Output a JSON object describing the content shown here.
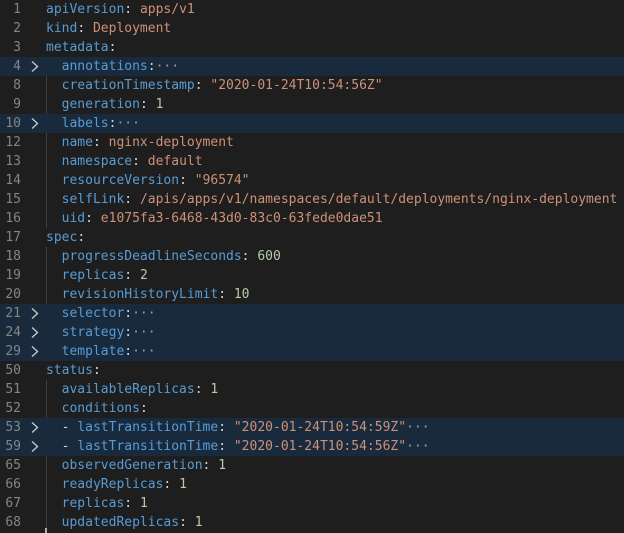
{
  "lines": [
    {
      "num": "1",
      "indent": "",
      "key": "apiVersion",
      "sep": ": ",
      "val": "apps/v1",
      "val_type": "s",
      "ellipsis": "",
      "folded": false
    },
    {
      "num": "2",
      "indent": "",
      "key": "kind",
      "sep": ": ",
      "val": "Deployment",
      "val_type": "s",
      "ellipsis": "",
      "folded": false
    },
    {
      "num": "3",
      "indent": "",
      "key": "metadata",
      "sep": ":",
      "val": "",
      "val_type": "s",
      "ellipsis": "",
      "folded": false
    },
    {
      "num": "4",
      "indent": "  ",
      "key": "annotations",
      "sep": ":",
      "val": "",
      "val_type": "s",
      "ellipsis": "···",
      "folded": true
    },
    {
      "num": "8",
      "indent": "  ",
      "key": "creationTimestamp",
      "sep": ": ",
      "val": "\"2020-01-24T10:54:56Z\"",
      "val_type": "s",
      "ellipsis": "",
      "folded": false
    },
    {
      "num": "9",
      "indent": "  ",
      "key": "generation",
      "sep": ": ",
      "val": "1",
      "val_type": "n",
      "ellipsis": "",
      "folded": false
    },
    {
      "num": "10",
      "indent": "  ",
      "key": "labels",
      "sep": ":",
      "val": "",
      "val_type": "s",
      "ellipsis": "···",
      "folded": true
    },
    {
      "num": "12",
      "indent": "  ",
      "key": "name",
      "sep": ": ",
      "val": "nginx-deployment",
      "val_type": "s",
      "ellipsis": "",
      "folded": false
    },
    {
      "num": "13",
      "indent": "  ",
      "key": "namespace",
      "sep": ": ",
      "val": "default",
      "val_type": "s",
      "ellipsis": "",
      "folded": false
    },
    {
      "num": "14",
      "indent": "  ",
      "key": "resourceVersion",
      "sep": ": ",
      "val": "\"96574\"",
      "val_type": "s",
      "ellipsis": "",
      "folded": false
    },
    {
      "num": "15",
      "indent": "  ",
      "key": "selfLink",
      "sep": ": ",
      "val": "/apis/apps/v1/namespaces/default/deployments/nginx-deployment",
      "val_type": "s",
      "ellipsis": "",
      "folded": false
    },
    {
      "num": "16",
      "indent": "  ",
      "key": "uid",
      "sep": ": ",
      "val": "e1075fa3-6468-43d0-83c0-63fede0dae51",
      "val_type": "s",
      "ellipsis": "",
      "folded": false
    },
    {
      "num": "17",
      "indent": "",
      "key": "spec",
      "sep": ":",
      "val": "",
      "val_type": "s",
      "ellipsis": "",
      "folded": false
    },
    {
      "num": "18",
      "indent": "  ",
      "key": "progressDeadlineSeconds",
      "sep": ": ",
      "val": "600",
      "val_type": "n",
      "ellipsis": "",
      "folded": false
    },
    {
      "num": "19",
      "indent": "  ",
      "key": "replicas",
      "sep": ": ",
      "val": "2",
      "val_type": "n",
      "ellipsis": "",
      "folded": false
    },
    {
      "num": "20",
      "indent": "  ",
      "key": "revisionHistoryLimit",
      "sep": ": ",
      "val": "10",
      "val_type": "n",
      "ellipsis": "",
      "folded": false
    },
    {
      "num": "21",
      "indent": "  ",
      "key": "selector",
      "sep": ":",
      "val": "",
      "val_type": "s",
      "ellipsis": "···",
      "folded": true
    },
    {
      "num": "24",
      "indent": "  ",
      "key": "strategy",
      "sep": ":",
      "val": "",
      "val_type": "s",
      "ellipsis": "···",
      "folded": true
    },
    {
      "num": "29",
      "indent": "  ",
      "key": "template",
      "sep": ":",
      "val": "",
      "val_type": "s",
      "ellipsis": "···",
      "folded": true
    },
    {
      "num": "50",
      "indent": "",
      "key": "status",
      "sep": ":",
      "val": "",
      "val_type": "s",
      "ellipsis": "",
      "folded": false
    },
    {
      "num": "51",
      "indent": "  ",
      "key": "availableReplicas",
      "sep": ": ",
      "val": "1",
      "val_type": "n",
      "ellipsis": "",
      "folded": false
    },
    {
      "num": "52",
      "indent": "  ",
      "key": "conditions",
      "sep": ":",
      "val": "",
      "val_type": "s",
      "ellipsis": "",
      "folded": false
    },
    {
      "num": "53",
      "indent": "  - ",
      "key": "lastTransitionTime",
      "sep": ": ",
      "val": "\"2020-01-24T10:54:59Z\"",
      "val_type": "s",
      "ellipsis": "···",
      "folded": true
    },
    {
      "num": "59",
      "indent": "  - ",
      "key": "lastTransitionTime",
      "sep": ": ",
      "val": "\"2020-01-24T10:54:56Z\"",
      "val_type": "s",
      "ellipsis": "···",
      "folded": true
    },
    {
      "num": "65",
      "indent": "  ",
      "key": "observedGeneration",
      "sep": ": ",
      "val": "1",
      "val_type": "n",
      "ellipsis": "",
      "folded": false
    },
    {
      "num": "66",
      "indent": "  ",
      "key": "readyReplicas",
      "sep": ": ",
      "val": "1",
      "val_type": "n",
      "ellipsis": "",
      "folded": false
    },
    {
      "num": "67",
      "indent": "  ",
      "key": "replicas",
      "sep": ": ",
      "val": "1",
      "val_type": "n",
      "ellipsis": "",
      "folded": false
    },
    {
      "num": "68",
      "indent": "  ",
      "key": "updatedReplicas",
      "sep": ": ",
      "val": "1",
      "val_type": "n",
      "ellipsis": "",
      "folded": false
    }
  ],
  "colors": {
    "key": "#569cd6",
    "string": "#ce9178",
    "number": "#b5cea8",
    "punctuation": "#d4d4d4",
    "line_number": "#858585",
    "folded_background": "#1a2a3d",
    "editor_background": "#1e1e1e"
  },
  "icons": {
    "fold": "chevron-right-icon"
  }
}
